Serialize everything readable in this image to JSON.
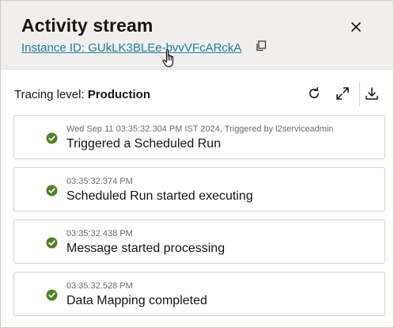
{
  "header": {
    "title": "Activity stream",
    "instance_label": "Instance ID: GUkLK3BLEe-bvvVFcARckA"
  },
  "icons": {
    "copy": "copy-icon",
    "close": "close-icon",
    "refresh": "refresh-icon",
    "expand": "expand-icon",
    "download": "download-icon",
    "status": "success-check-icon",
    "pointer": "hand-pointer-cursor-icon"
  },
  "colors": {
    "header_bg": "#f1efed",
    "link": "#227e9e",
    "success": "#508223"
  },
  "toolbar": {
    "tracing_label": "Tracing level:",
    "tracing_value": "Production"
  },
  "events": [
    {
      "meta": "Wed Sep 11 03:35:32.304 PM IST 2024, Triggered by l2serviceadmin",
      "message": "Triggered a Scheduled Run"
    },
    {
      "meta": "03:35:32.374 PM",
      "message": "Scheduled Run started executing"
    },
    {
      "meta": "03:35:32.438 PM",
      "message": "Message started processing"
    },
    {
      "meta": "03:35:32.528 PM",
      "message": "Data Mapping completed"
    }
  ]
}
